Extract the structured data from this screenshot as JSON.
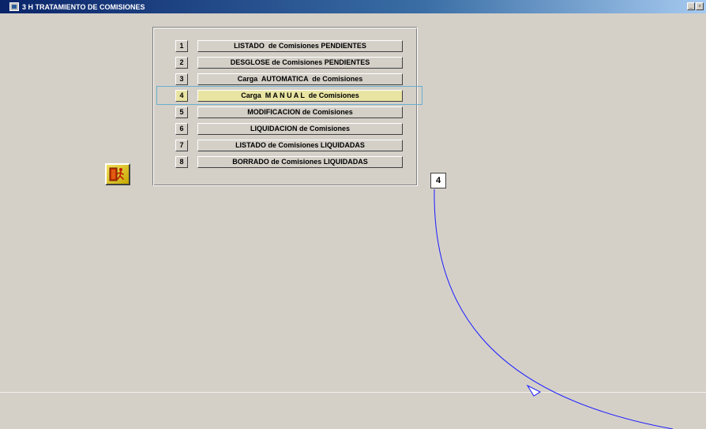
{
  "window": {
    "title": "3 H TRATAMIENTO DE COMISIONES",
    "minimize_glyph": "_",
    "restore_glyph": "▫"
  },
  "menu": {
    "items": [
      {
        "number": "1",
        "label": "LISTADO  de Comisiones PENDIENTES"
      },
      {
        "number": "2",
        "label": "DESGLOSE de Comisiones PENDIENTES"
      },
      {
        "number": "3",
        "label": "Carga  AUTOMATICA  de Comisiones"
      },
      {
        "number": "4",
        "label": "Carga  M A N U A L  de Comisiones"
      },
      {
        "number": "5",
        "label": "MODIFICACION de Comisiones"
      },
      {
        "number": "6",
        "label": "LIQUIDACION de Comisiones"
      },
      {
        "number": "7",
        "label": "LISTADO de Comisiones LIQUIDADAS"
      },
      {
        "number": "8",
        "label": "BORRADO de Comisiones LIQUIDADAS"
      }
    ],
    "selected_number": "4"
  },
  "option_field": {
    "value": "4"
  },
  "icons": {
    "exit": "exit-door-running-man-icon",
    "app": "app-window-icon"
  },
  "colors": {
    "background": "#d4d0c8",
    "title_bar": "#0a246a",
    "selection": "#e9e4a2",
    "focus_frame": "#6aaed0",
    "arc": "#1a1aff"
  }
}
